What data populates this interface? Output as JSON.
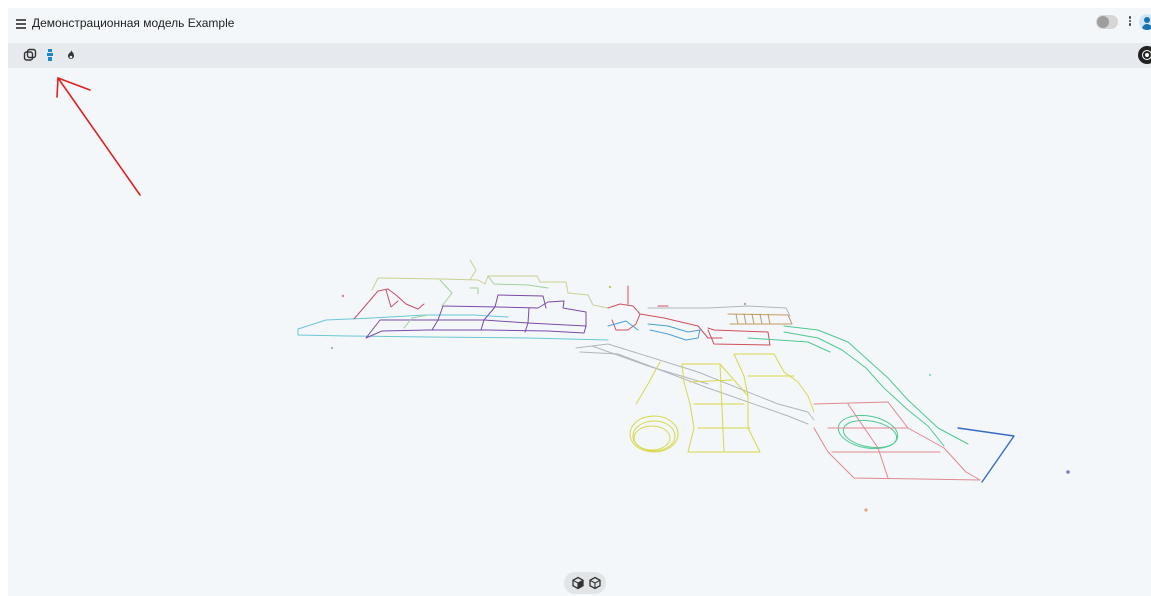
{
  "header": {
    "title": "Демонстрационная модель Example",
    "menu_icon": "hamburger-menu-icon",
    "actions": [
      {
        "name": "toggle-switch",
        "state": "off"
      },
      {
        "name": "more-vert-icon"
      },
      {
        "name": "user-avatar-icon"
      }
    ]
  },
  "toolbar": {
    "tools": [
      {
        "name": "layers-icon"
      },
      {
        "name": "pipes-icon",
        "active": true
      },
      {
        "name": "fire-icon"
      }
    ],
    "right_tool": "target-icon"
  },
  "bottom_controls": [
    {
      "name": "cube-3d-icon"
    },
    {
      "name": "cube-outline-icon"
    }
  ],
  "colors": {
    "background": "#f3f7fa",
    "toolbar": "#e6eaee",
    "annotation_arrow": "#e02020",
    "active_tool": "#1e88c8"
  }
}
